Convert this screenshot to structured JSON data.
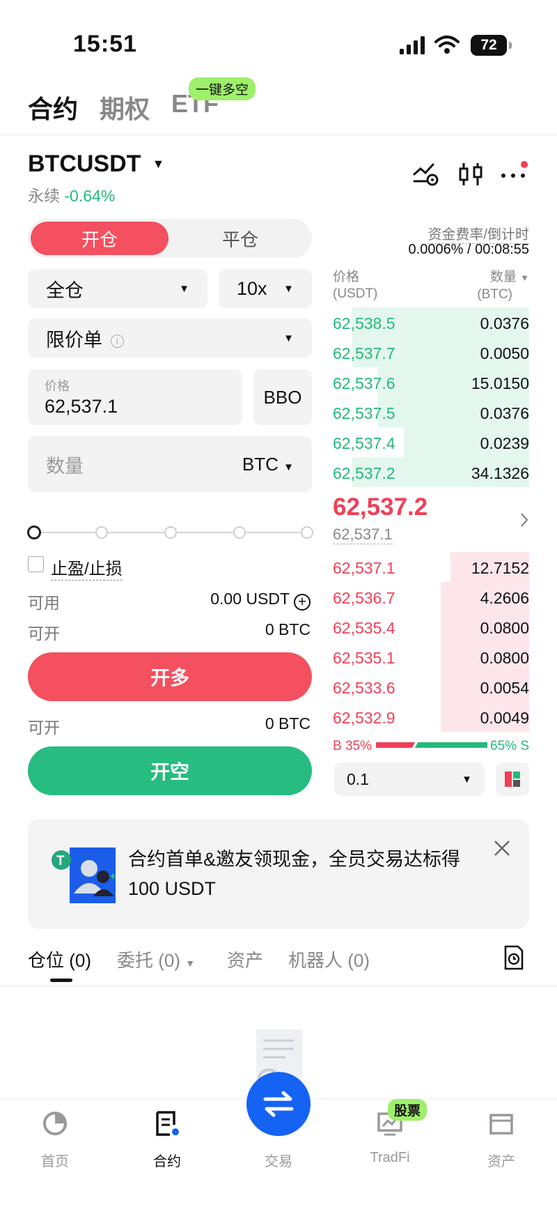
{
  "status_bar": {
    "time": "15:51",
    "battery": "72"
  },
  "top_tabs": [
    {
      "label": "合约",
      "active": true
    },
    {
      "label": "期权",
      "active": false
    },
    {
      "label": "ETF",
      "active": false
    }
  ],
  "promo_badge": "一键多空",
  "symbol": {
    "name": "BTCUSDT",
    "type": "永续",
    "change": "-0.64%"
  },
  "order_form": {
    "tab_open": "开仓",
    "tab_close": "平仓",
    "margin_mode": "全仓",
    "leverage": "10x",
    "order_type": "限价单",
    "price_label": "价格",
    "price_value": "62,537.1",
    "bbo_label": "BBO",
    "qty_placeholder": "数量",
    "qty_unit": "BTC",
    "tpsl_label": "止盈/止损",
    "available_label": "可用",
    "available_value": "0.00 USDT",
    "open_label": "可开",
    "open_long_value": "0 BTC",
    "open_short_value": "0 BTC",
    "long_button": "开多",
    "short_button": "开空",
    "slider_position": 0
  },
  "funding": {
    "label": "资金费率/倒计时",
    "value": "0.0006% / 00:08:55"
  },
  "orderbook": {
    "price_header": "价格",
    "price_unit": "(USDT)",
    "qty_header": "数量",
    "qty_unit": "(BTC)",
    "asks": [
      {
        "price": "62,538.5",
        "qty": "0.0376",
        "depth": 0.9
      },
      {
        "price": "62,537.7",
        "qty": "0.0050",
        "depth": 0.9
      },
      {
        "price": "62,537.6",
        "qty": "15.0150",
        "depth": 0.77
      },
      {
        "price": "62,537.5",
        "qty": "0.0376",
        "depth": 0.77
      },
      {
        "price": "62,537.4",
        "qty": "0.0239",
        "depth": 0.64
      },
      {
        "price": "62,537.2",
        "qty": "34.1326",
        "depth": 0.9
      }
    ],
    "last_price": "62,537.2",
    "mark_price": "62,537.1",
    "bids": [
      {
        "price": "62,537.1",
        "qty": "12.7152",
        "depth": 0.4
      },
      {
        "price": "62,536.7",
        "qty": "4.2606",
        "depth": 0.45
      },
      {
        "price": "62,535.4",
        "qty": "0.0800",
        "depth": 0.45
      },
      {
        "price": "62,535.1",
        "qty": "0.0800",
        "depth": 0.45
      },
      {
        "price": "62,533.6",
        "qty": "0.0054",
        "depth": 0.45
      },
      {
        "price": "62,532.9",
        "qty": "0.0049",
        "depth": 0.45
      }
    ],
    "buy_ratio": "B 35%",
    "sell_ratio": "65% S",
    "buy_pct": 35,
    "precision": "0.1"
  },
  "banner": {
    "line1": "合约首单&邀友领现金，全员交易达标得",
    "line2": "100 USDT"
  },
  "bottom_tabs": [
    {
      "label": "仓位 (0)",
      "active": true
    },
    {
      "label": "委托 (0)",
      "active": false
    },
    {
      "label": "资产",
      "active": false
    },
    {
      "label": "机器人 (0)",
      "active": false
    }
  ],
  "nav": [
    {
      "label": "首页",
      "icon": "home-icon",
      "active": false
    },
    {
      "label": "合约",
      "icon": "contract-icon",
      "active": true
    },
    {
      "label": "交易",
      "icon": "swap-icon",
      "active": false
    },
    {
      "label": "TradFi",
      "icon": "tradfi-icon",
      "active": false
    },
    {
      "label": "资产",
      "icon": "wallet-icon",
      "active": false
    }
  ],
  "nav_badge": "股票",
  "colors": {
    "red": "#ef4058",
    "green": "#25b97a",
    "blue": "#1463f3",
    "badge": "#9ef06a"
  }
}
